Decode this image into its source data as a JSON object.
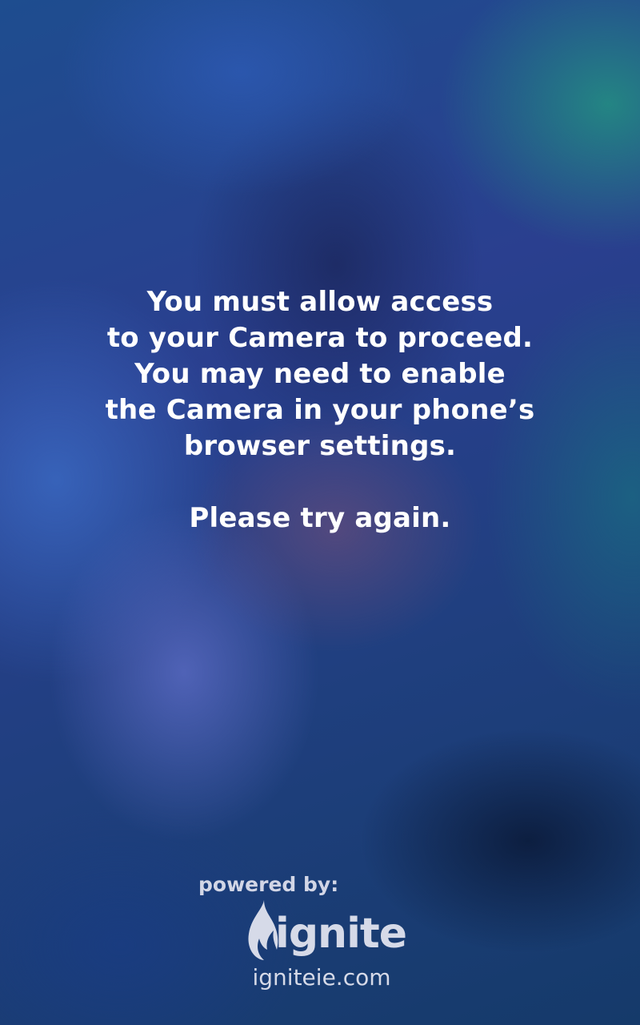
{
  "message": {
    "lines": [
      "You must allow access",
      "to your Camera to proceed.",
      "You may need to enable",
      "the Camera in your phone’s",
      "browser settings."
    ],
    "retry": "Please try again."
  },
  "footer": {
    "powered_by": "powered by:",
    "logo": {
      "icon": "flame-icon",
      "wordmark": "ignite"
    },
    "url": "igniteie.com"
  },
  "colors": {
    "text": "#ffffff",
    "footer_text": "#d2d6e6",
    "background_primary": "#233a7c",
    "background_accent": "#238c82"
  }
}
